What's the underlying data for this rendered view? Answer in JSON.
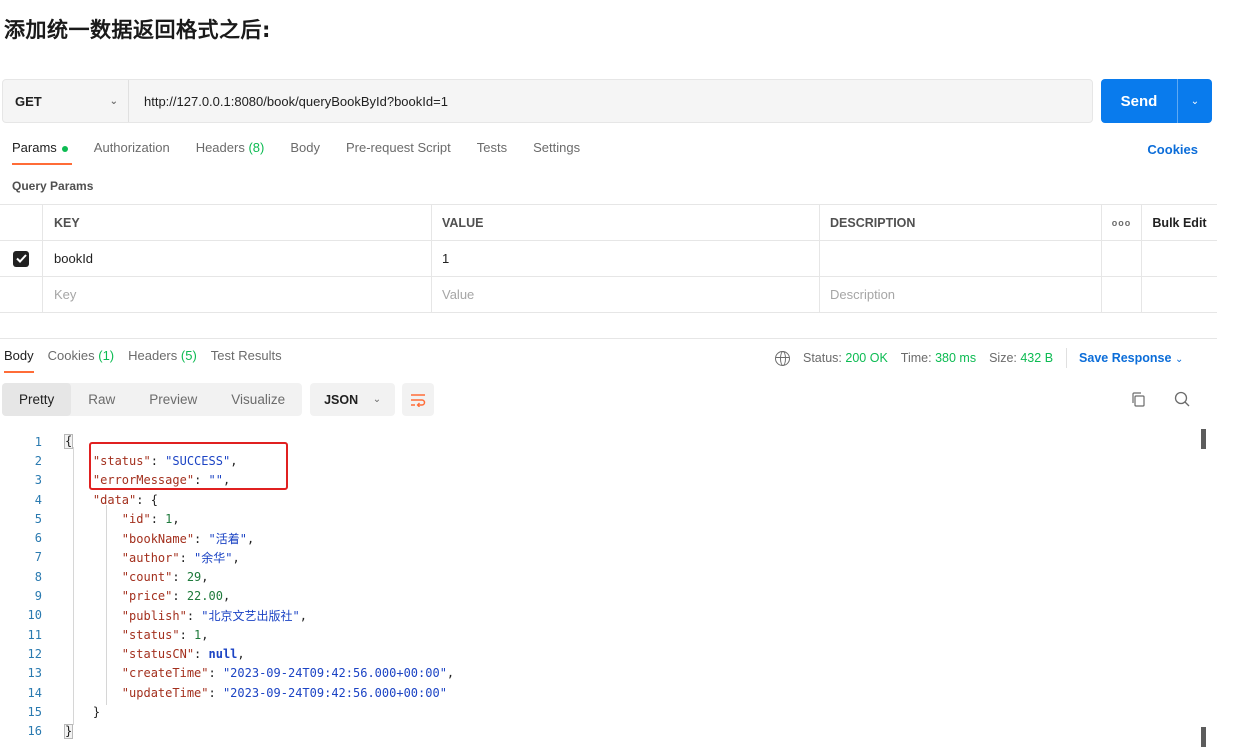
{
  "heading": "添加统一数据返回格式之后:",
  "request": {
    "method": "GET",
    "url": "http://127.0.0.1:8080/book/queryBookById?bookId=1",
    "send_label": "Send"
  },
  "request_tabs": {
    "params": "Params",
    "authorization": "Authorization",
    "headers": "Headers",
    "headers_count": "(8)",
    "body": "Body",
    "prerequest": "Pre-request Script",
    "tests": "Tests",
    "settings": "Settings",
    "cookies": "Cookies"
  },
  "query_params": {
    "title": "Query Params",
    "columns": {
      "key": "KEY",
      "value": "VALUE",
      "description": "DESCRIPTION",
      "more": "ooo",
      "bulk_edit": "Bulk Edit"
    },
    "rows": [
      {
        "checked": true,
        "key": "bookId",
        "value": "1",
        "description": ""
      }
    ],
    "placeholder": {
      "key": "Key",
      "value": "Value",
      "description": "Description"
    }
  },
  "response_tabs": {
    "body": "Body",
    "cookies": "Cookies",
    "cookies_count": "(1)",
    "headers": "Headers",
    "headers_count": "(5)",
    "test_results": "Test Results"
  },
  "response_status": {
    "status_label": "Status:",
    "status_value": "200 OK",
    "time_label": "Time:",
    "time_value": "380 ms",
    "size_label": "Size:",
    "size_value": "432 B",
    "save_response": "Save Response"
  },
  "view": {
    "modes": [
      "Pretty",
      "Raw",
      "Preview",
      "Visualize"
    ],
    "active_mode": "Pretty",
    "format": "JSON"
  },
  "code_lines": [
    "1",
    "2",
    "3",
    "4",
    "5",
    "6",
    "7",
    "8",
    "9",
    "10",
    "11",
    "12",
    "13",
    "14",
    "15",
    "16"
  ],
  "json": {
    "status_key": "\"status\"",
    "status_val": "\"SUCCESS\"",
    "errorMessage_key": "\"errorMessage\"",
    "errorMessage_val": "\"\"",
    "data_key": "\"data\"",
    "id_key": "\"id\"",
    "id_val": "1",
    "bookName_key": "\"bookName\"",
    "bookName_val": "\"活着\"",
    "author_key": "\"author\"",
    "author_val": "\"余华\"",
    "count_key": "\"count\"",
    "count_val": "29",
    "price_key": "\"price\"",
    "price_val": "22.00",
    "publish_key": "\"publish\"",
    "publish_val": "\"北京文艺出版社\"",
    "status2_key": "\"status\"",
    "status2_val": "1",
    "statusCN_key": "\"statusCN\"",
    "statusCN_val": "null",
    "createTime_key": "\"createTime\"",
    "createTime_val": "\"2023-09-24T09:42:56.000+00:00\"",
    "updateTime_key": "\"updateTime\"",
    "updateTime_val": "\"2023-09-24T09:42:56.000+00:00\""
  },
  "colors": {
    "send": "#097bed",
    "tab_underline": "#ff6c37",
    "status_ok": "#0cbb52",
    "highlight_box": "#e02020"
  }
}
